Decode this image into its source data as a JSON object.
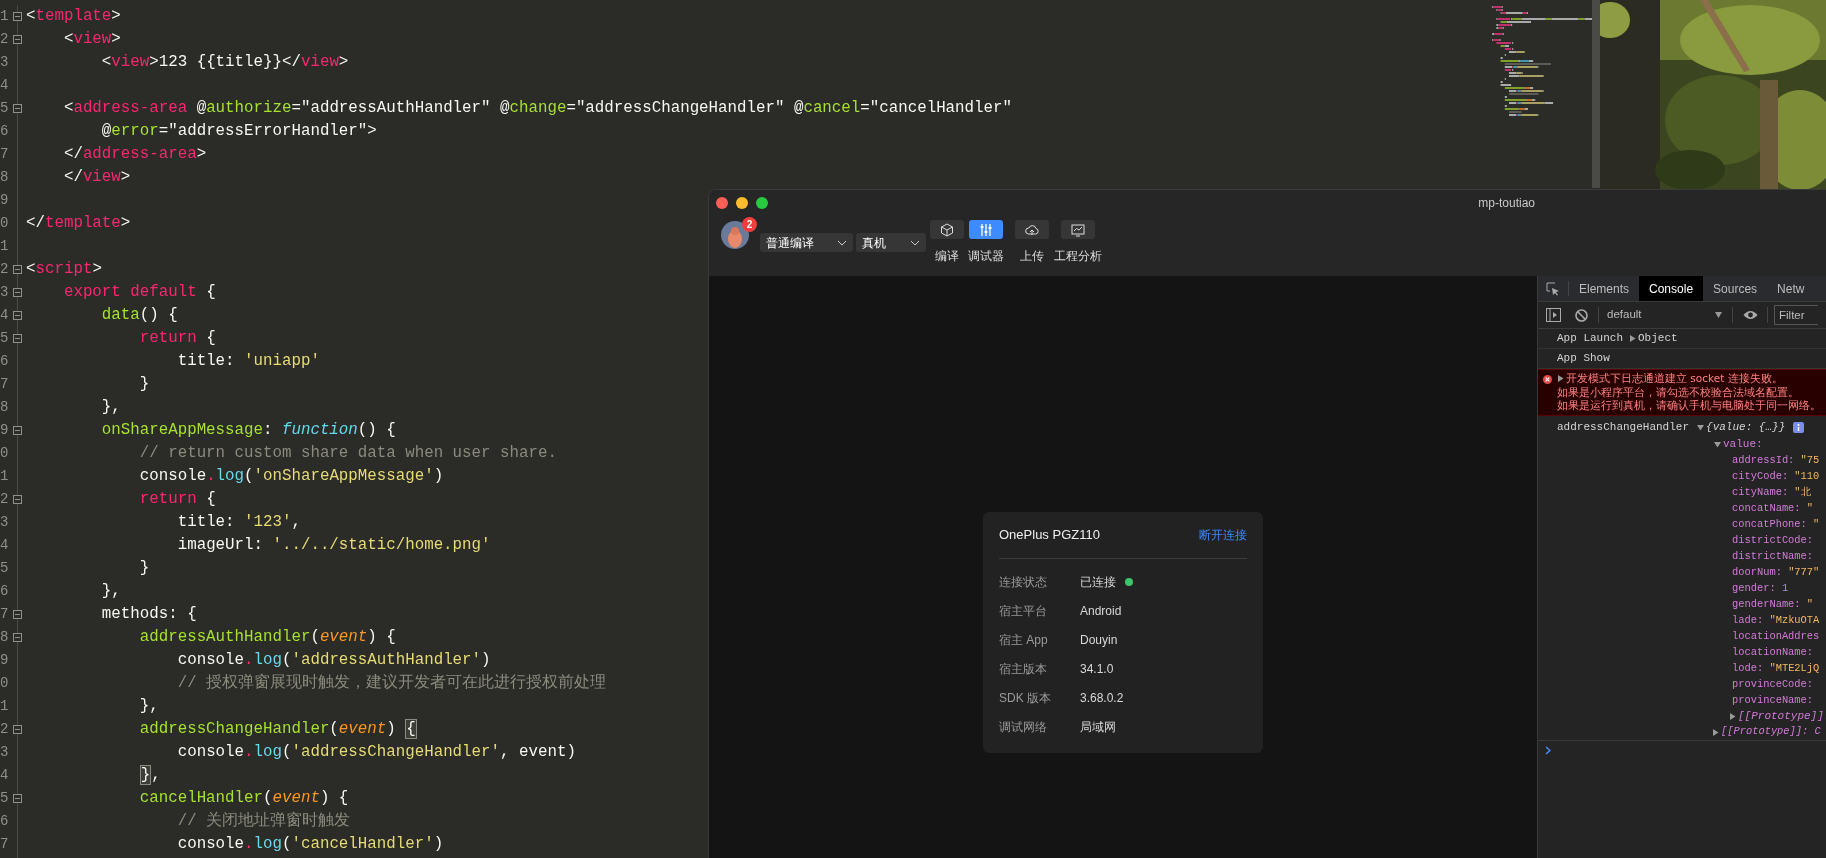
{
  "editor": {
    "lines": [
      {
        "number": "1",
        "foldable": true,
        "tokens": [
          {
            "kind": "p",
            "text": "<"
          },
          {
            "kind": "tag",
            "text": "template"
          },
          {
            "kind": "p",
            "text": ">"
          }
        ]
      },
      {
        "number": "2",
        "foldable": true,
        "tokens": [
          {
            "kind": "p",
            "text": "    <"
          },
          {
            "kind": "tag",
            "text": "view"
          },
          {
            "kind": "p",
            "text": ">"
          }
        ]
      },
      {
        "number": "3",
        "foldable": false,
        "tokens": [
          {
            "kind": "p",
            "text": "        <"
          },
          {
            "kind": "tag",
            "text": "view"
          },
          {
            "kind": "p",
            "text": ">123 {{title}}</"
          },
          {
            "kind": "tag",
            "text": "view"
          },
          {
            "kind": "p",
            "text": ">"
          }
        ]
      },
      {
        "number": "4",
        "foldable": false
      },
      {
        "number": "5",
        "foldable": true,
        "tokens": [
          {
            "kind": "p",
            "text": "    <"
          },
          {
            "kind": "tag",
            "text": "address-area"
          },
          {
            "kind": "p",
            "text": " @"
          },
          {
            "kind": "attr",
            "text": "authorize"
          },
          {
            "kind": "p",
            "text": "=\"addressAuthHandler\" @"
          },
          {
            "kind": "attr",
            "text": "change"
          },
          {
            "kind": "p",
            "text": "=\"addressChangeHandler\" @"
          },
          {
            "kind": "attr",
            "text": "cancel"
          },
          {
            "kind": "p",
            "text": "=\"cancelHandler\""
          }
        ]
      },
      {
        "number": "6",
        "foldable": false,
        "tokens": [
          {
            "kind": "p",
            "text": "        @"
          },
          {
            "kind": "attr",
            "text": "error"
          },
          {
            "kind": "p",
            "text": "=\"addressErrorHandler\">"
          }
        ]
      },
      {
        "number": "7",
        "foldable": false,
        "tokens": [
          {
            "kind": "p",
            "text": "    </"
          },
          {
            "kind": "tag",
            "text": "address-area"
          },
          {
            "kind": "p",
            "text": ">"
          }
        ]
      },
      {
        "number": "8",
        "foldable": false,
        "tokens": [
          {
            "kind": "p",
            "text": "    </"
          },
          {
            "kind": "tag",
            "text": "view"
          },
          {
            "kind": "p",
            "text": ">"
          }
        ]
      },
      {
        "number": "9",
        "foldable": false
      },
      {
        "number": "0",
        "foldable": false,
        "tokens": [
          {
            "kind": "p",
            "text": "</"
          },
          {
            "kind": "tag",
            "text": "template"
          },
          {
            "kind": "p",
            "text": ">"
          }
        ]
      },
      {
        "number": "1",
        "foldable": false
      },
      {
        "number": "2",
        "foldable": true,
        "tokens": [
          {
            "kind": "p",
            "text": "<"
          },
          {
            "kind": "tag",
            "text": "script"
          },
          {
            "kind": "p",
            "text": ">"
          }
        ]
      },
      {
        "number": "3",
        "foldable": true,
        "tokens": [
          {
            "kind": "kw",
            "text": "    export default"
          },
          {
            "kind": "p",
            "text": " {"
          }
        ]
      },
      {
        "number": "4",
        "foldable": true,
        "tokens": [
          {
            "kind": "fn",
            "text": "        data"
          },
          {
            "kind": "p",
            "text": "() {"
          }
        ]
      },
      {
        "number": "5",
        "foldable": true,
        "tokens": [
          {
            "kind": "kw",
            "text": "            return"
          },
          {
            "kind": "p",
            "text": " {"
          }
        ]
      },
      {
        "number": "6",
        "foldable": false,
        "tokens": [
          {
            "kind": "p",
            "text": "                title: "
          },
          {
            "kind": "str",
            "text": "'uniapp'"
          }
        ]
      },
      {
        "number": "7",
        "foldable": false,
        "tokens": [
          {
            "kind": "p",
            "text": "            }"
          }
        ]
      },
      {
        "number": "8",
        "foldable": false,
        "tokens": [
          {
            "kind": "p",
            "text": "        },"
          }
        ]
      },
      {
        "number": "9",
        "foldable": true,
        "tokens": [
          {
            "kind": "fn",
            "text": "        onShareAppMessage"
          },
          {
            "kind": "p",
            "text": ": "
          },
          {
            "kind": "it",
            "text": "function"
          },
          {
            "kind": "p",
            "text": "() {"
          }
        ]
      },
      {
        "number": "0",
        "foldable": false,
        "tokens": [
          {
            "kind": "cm",
            "text": "            // return custom share data when user share."
          }
        ]
      },
      {
        "number": "1",
        "foldable": false,
        "tokens": [
          {
            "kind": "p",
            "text": "            console"
          },
          {
            "kind": "dot",
            "text": "."
          },
          {
            "kind": "log",
            "text": "log"
          },
          {
            "kind": "p",
            "text": "("
          },
          {
            "kind": "str",
            "text": "'onShareAppMessage'"
          },
          {
            "kind": "p",
            "text": ")"
          }
        ]
      },
      {
        "number": "2",
        "foldable": true,
        "tokens": [
          {
            "kind": "kw",
            "text": "            return"
          },
          {
            "kind": "p",
            "text": " {"
          }
        ]
      },
      {
        "number": "3",
        "foldable": false,
        "tokens": [
          {
            "kind": "p",
            "text": "                title: "
          },
          {
            "kind": "str",
            "text": "'123'"
          },
          {
            "kind": "p",
            "text": ","
          }
        ]
      },
      {
        "number": "4",
        "foldable": false,
        "tokens": [
          {
            "kind": "p",
            "text": "                imageUrl: "
          },
          {
            "kind": "str",
            "text": "'../../static/home.png'"
          }
        ]
      },
      {
        "number": "5",
        "foldable": false,
        "tokens": [
          {
            "kind": "p",
            "text": "            }"
          }
        ]
      },
      {
        "number": "6",
        "foldable": false,
        "tokens": [
          {
            "kind": "p",
            "text": "        },"
          }
        ]
      },
      {
        "number": "7",
        "foldable": true,
        "tokens": [
          {
            "kind": "p",
            "text": "        methods: {"
          }
        ]
      },
      {
        "number": "8",
        "foldable": true,
        "tokens": [
          {
            "kind": "fn",
            "text": "            addressAuthHandler"
          },
          {
            "kind": "p",
            "text": "("
          },
          {
            "kind": "param",
            "text": "event"
          },
          {
            "kind": "p",
            "text": ") {"
          }
        ]
      },
      {
        "number": "9",
        "foldable": false,
        "tokens": [
          {
            "kind": "p",
            "text": "                console"
          },
          {
            "kind": "dot",
            "text": "."
          },
          {
            "kind": "log",
            "text": "log"
          },
          {
            "kind": "p",
            "text": "("
          },
          {
            "kind": "str",
            "text": "'addressAuthHandler'"
          },
          {
            "kind": "p",
            "text": ")"
          }
        ]
      },
      {
        "number": "0",
        "foldable": false,
        "tokens": [
          {
            "kind": "cm",
            "text": "                // 授权弹窗展现时触发，建议开发者可在此进行授权前处理"
          }
        ]
      },
      {
        "number": "1",
        "foldable": false,
        "tokens": [
          {
            "kind": "p",
            "text": "            },"
          }
        ]
      },
      {
        "number": "2",
        "foldable": true,
        "tokens": [
          {
            "kind": "fn",
            "text": "            addressChangeHandler"
          },
          {
            "kind": "p",
            "text": "("
          },
          {
            "kind": "param",
            "text": "event"
          },
          {
            "kind": "p",
            "text": ") "
          },
          {
            "kind": "match",
            "text": "{"
          }
        ]
      },
      {
        "number": "3",
        "foldable": false,
        "tokens": [
          {
            "kind": "p",
            "text": "                console"
          },
          {
            "kind": "dot",
            "text": "."
          },
          {
            "kind": "log",
            "text": "log"
          },
          {
            "kind": "p",
            "text": "("
          },
          {
            "kind": "str",
            "text": "'addressChangeHandler'"
          },
          {
            "kind": "p",
            "text": ", event)"
          }
        ]
      },
      {
        "number": "4",
        "foldable": false,
        "tokens": [
          {
            "kind": "match",
            "text": "            }"
          },
          {
            "kind": "p",
            "text": ","
          }
        ]
      },
      {
        "number": "5",
        "foldable": true,
        "tokens": [
          {
            "kind": "fn",
            "text": "            cancelHandler"
          },
          {
            "kind": "p",
            "text": "("
          },
          {
            "kind": "param",
            "text": "event"
          },
          {
            "kind": "p",
            "text": ") {"
          }
        ]
      },
      {
        "number": "6",
        "foldable": false,
        "tokens": [
          {
            "kind": "cm",
            "text": "                // 关闭地址弹窗时触发"
          }
        ]
      },
      {
        "number": "7",
        "foldable": false,
        "tokens": [
          {
            "kind": "p",
            "text": "                console"
          },
          {
            "kind": "dot",
            "text": "."
          },
          {
            "kind": "log",
            "text": "log"
          },
          {
            "kind": "p",
            "text": "("
          },
          {
            "kind": "str",
            "text": "'cancelHandler'"
          },
          {
            "kind": "p",
            "text": ")"
          }
        ]
      }
    ]
  },
  "devtools_window": {
    "title": "mp-toutiao",
    "avatar_badge": "2",
    "compile_mode": "普通编译",
    "target": "真机",
    "toolbar": [
      {
        "kind": "cube",
        "label": "编译",
        "selected": false
      },
      {
        "kind": "sliders",
        "label": "调试器",
        "selected": true
      },
      {
        "kind": "cloud",
        "label": "上传",
        "selected": false
      },
      {
        "kind": "chart",
        "label": "工程分析",
        "selected": false
      }
    ]
  },
  "device_card": {
    "name": "OnePlus PGZ110",
    "action": "断开连接",
    "rows": [
      {
        "label": "连接状态",
        "value": "已连接",
        "connected": true
      },
      {
        "label": "宿主平台",
        "value": "Android"
      },
      {
        "label": "宿主 App",
        "value": "Douyin"
      },
      {
        "label": "宿主版本",
        "value": "34.1.0"
      },
      {
        "label": "SDK 版本",
        "value": "3.68.0.2"
      },
      {
        "label": "调试网络",
        "value": "局域网"
      }
    ]
  },
  "devtools": {
    "tabs": [
      {
        "label": "Elements",
        "selected": false
      },
      {
        "label": "Console",
        "selected": true
      },
      {
        "label": "Sources",
        "selected": false
      },
      {
        "label": "Netw",
        "selected": false
      }
    ],
    "context": "default",
    "filter_placeholder": "Filter",
    "console": [
      {
        "kind": "log",
        "text": "App Launch",
        "object": "Object",
        "expanded": false
      },
      {
        "kind": "log",
        "text": "App Show"
      },
      {
        "kind": "error",
        "expanded": false,
        "lines": [
          "开发模式下日志通道建立 socket 连接失败。",
          "如果是小程序平台，请勾选不校验合法域名配置。",
          "如果是运行到真机，请确认手机与电脑处于同一网络。"
        ]
      },
      {
        "kind": "object",
        "text": "addressChangeHandler",
        "summary": "{value: {…}}",
        "expanded": true,
        "child": {
          "key": "value:",
          "expanded": true,
          "properties": [
            {
              "key": "addressId:",
              "value": "\"75",
              "kind": "string"
            },
            {
              "key": "cityCode:",
              "value": "\"110",
              "kind": "string"
            },
            {
              "key": "cityName:",
              "value": "\"北",
              "kind": "string"
            },
            {
              "key": "concatName:",
              "value": "\"",
              "kind": "string"
            },
            {
              "key": "concatPhone:",
              "value": "\"",
              "kind": "string"
            },
            {
              "key": "districtCode:"
            },
            {
              "key": "districtName:"
            },
            {
              "key": "doorNum:",
              "value": "\"777\"",
              "kind": "string"
            },
            {
              "key": "gender:",
              "value": "1",
              "kind": "number"
            },
            {
              "key": "genderName:",
              "value": "\"",
              "kind": "string"
            },
            {
              "key": "lade:",
              "value": "\"MzkuOTA",
              "kind": "string"
            },
            {
              "key": "locationAddres"
            },
            {
              "key": "locationName:"
            },
            {
              "key": "lode:",
              "value": "\"MTE2LjQ",
              "kind": "string"
            },
            {
              "key": "provinceCode:"
            },
            {
              "key": "provinceName:"
            }
          ],
          "prototype": {
            "text": "[[Prototype]]:",
            "expanded": false
          }
        },
        "prototype": {
          "text": "[[Prototype]]: C",
          "expanded": false
        }
      }
    ]
  }
}
